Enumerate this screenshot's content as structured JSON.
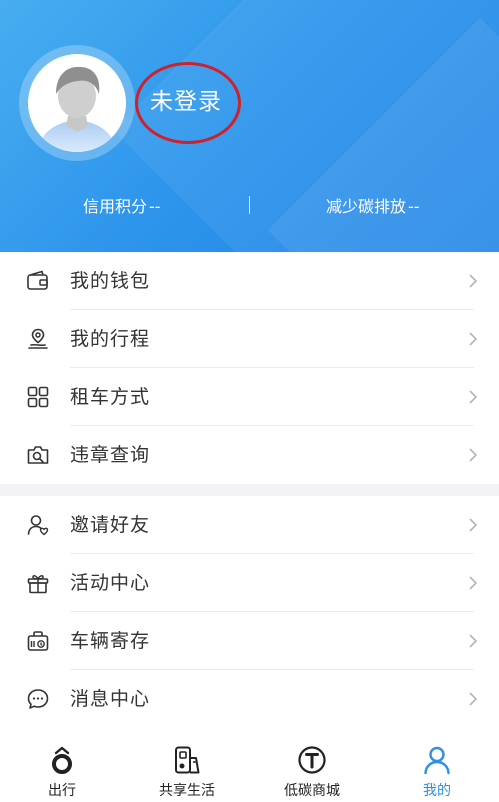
{
  "profile": {
    "login_status": "未登录",
    "credit_label": "信用积分",
    "credit_value": "--",
    "carbon_label": "减少碳排放",
    "carbon_value": "--"
  },
  "menu_group1": [
    {
      "label": "我的钱包",
      "icon": "wallet-icon"
    },
    {
      "label": "我的行程",
      "icon": "route-pin-icon"
    },
    {
      "label": "租车方式",
      "icon": "grid-icon"
    },
    {
      "label": "违章查询",
      "icon": "camera-search-icon"
    }
  ],
  "menu_group2": [
    {
      "label": "邀请好友",
      "icon": "user-heart-icon"
    },
    {
      "label": "活动中心",
      "icon": "gift-icon"
    },
    {
      "label": "车辆寄存",
      "icon": "storage-lock-icon"
    },
    {
      "label": "消息中心",
      "icon": "message-icon"
    }
  ],
  "tabs": [
    {
      "label": "出行",
      "icon": "travel-icon",
      "active": false
    },
    {
      "label": "共享生活",
      "icon": "share-life-icon",
      "active": false
    },
    {
      "label": "低碳商城",
      "icon": "t-circle-icon",
      "active": false
    },
    {
      "label": "我的",
      "icon": "person-icon",
      "active": true
    }
  ],
  "colors": {
    "header_blue": "#2f96ec",
    "active_tab": "#2d8fe8",
    "highlight_circle": "#d0202a"
  }
}
